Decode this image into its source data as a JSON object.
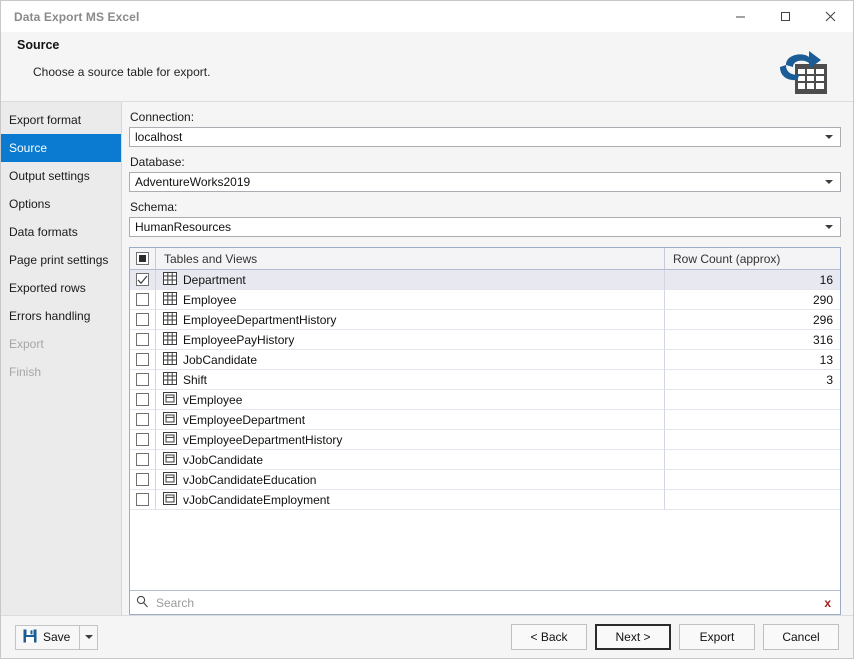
{
  "window": {
    "title": "Data Export MS Excel",
    "controls": {
      "minimize": "minimize-icon",
      "maximize": "maximize-icon",
      "close": "close-icon"
    },
    "logo_icon": "excel-export-icon"
  },
  "header": {
    "heading": "Source",
    "subheading": "Choose a source table for export."
  },
  "sidebar": {
    "items": [
      {
        "label": "Export format",
        "state": "normal"
      },
      {
        "label": "Source",
        "state": "active"
      },
      {
        "label": "Output settings",
        "state": "normal"
      },
      {
        "label": "Options",
        "state": "normal"
      },
      {
        "label": "Data formats",
        "state": "normal"
      },
      {
        "label": "Page print settings",
        "state": "normal"
      },
      {
        "label": "Exported rows",
        "state": "normal"
      },
      {
        "label": "Errors handling",
        "state": "normal"
      },
      {
        "label": "Export",
        "state": "disabled"
      },
      {
        "label": "Finish",
        "state": "disabled"
      }
    ],
    "active_color": "#0a7bd1"
  },
  "form": {
    "connection": {
      "label": "Connection:",
      "value": "localhost"
    },
    "database": {
      "label": "Database:",
      "value": "AdventureWorks2019"
    },
    "schema": {
      "label": "Schema:",
      "value": "HumanResources"
    }
  },
  "grid": {
    "columns": [
      "Tables and Views",
      "Row Count (approx)"
    ],
    "header_checkbox_state": "indeterminate",
    "rows": [
      {
        "checked": true,
        "selected": true,
        "icon": "table-icon",
        "name": "Department",
        "row_count": "16"
      },
      {
        "checked": false,
        "selected": false,
        "icon": "table-icon",
        "name": "Employee",
        "row_count": "290"
      },
      {
        "checked": false,
        "selected": false,
        "icon": "table-icon",
        "name": "EmployeeDepartmentHistory",
        "row_count": "296"
      },
      {
        "checked": false,
        "selected": false,
        "icon": "table-icon",
        "name": "EmployeePayHistory",
        "row_count": "316"
      },
      {
        "checked": false,
        "selected": false,
        "icon": "table-icon",
        "name": "JobCandidate",
        "row_count": "13"
      },
      {
        "checked": false,
        "selected": false,
        "icon": "table-icon",
        "name": "Shift",
        "row_count": "3"
      },
      {
        "checked": false,
        "selected": false,
        "icon": "view-icon",
        "name": "vEmployee",
        "row_count": ""
      },
      {
        "checked": false,
        "selected": false,
        "icon": "view-icon",
        "name": "vEmployeeDepartment",
        "row_count": ""
      },
      {
        "checked": false,
        "selected": false,
        "icon": "view-icon",
        "name": "vEmployeeDepartmentHistory",
        "row_count": ""
      },
      {
        "checked": false,
        "selected": false,
        "icon": "view-icon",
        "name": "vJobCandidate",
        "row_count": ""
      },
      {
        "checked": false,
        "selected": false,
        "icon": "view-icon",
        "name": "vJobCandidateEducation",
        "row_count": ""
      },
      {
        "checked": false,
        "selected": false,
        "icon": "view-icon",
        "name": "vJobCandidateEmployment",
        "row_count": ""
      }
    ],
    "search": {
      "placeholder": "Search",
      "value": "",
      "icon": "search-icon",
      "clear_icon": "clear-x-icon",
      "clear_label": "x"
    }
  },
  "footer": {
    "save_label": "Save",
    "save_icon": "save-disk-icon",
    "save_dropdown_icon": "chevron-down-icon",
    "buttons": [
      {
        "label": "< Back",
        "default": false
      },
      {
        "label": "Next >",
        "default": true
      },
      {
        "label": "Export",
        "default": false
      },
      {
        "label": "Cancel",
        "default": false
      }
    ]
  }
}
